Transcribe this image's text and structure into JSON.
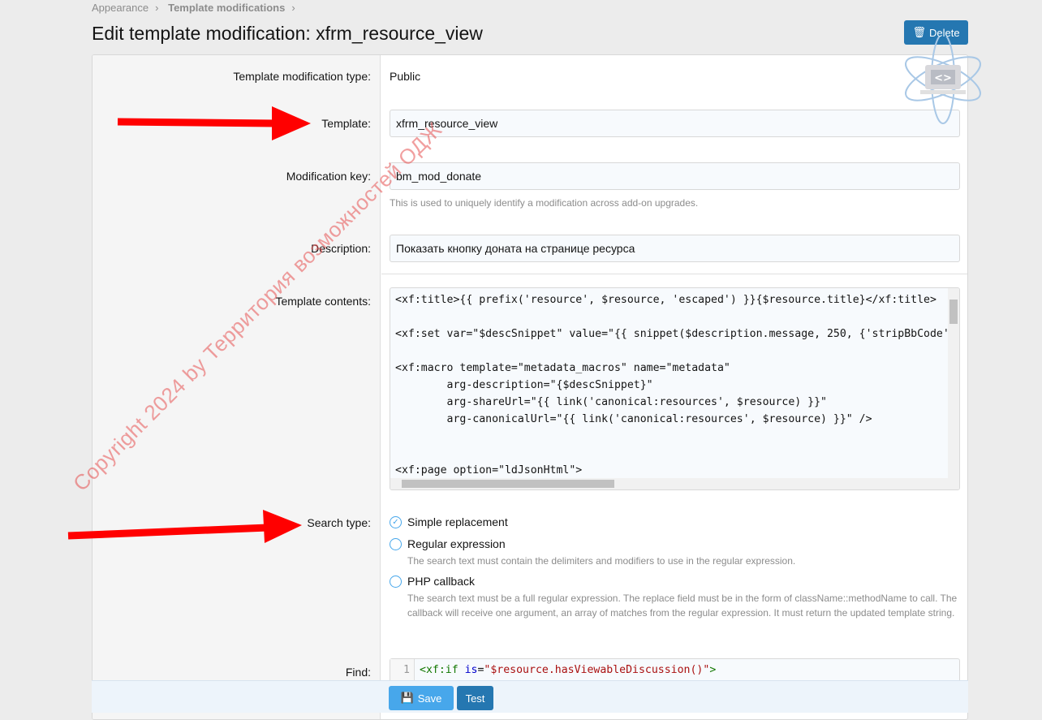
{
  "breadcrumb": [
    "Appearance",
    "Template modifications"
  ],
  "title": "Edit template modification: xfrm_resource_view",
  "delete_label": "Delete",
  "fields": {
    "type_label": "Template modification type:",
    "type_value": "Public",
    "template_label": "Template:",
    "template_value": "xfrm_resource_view",
    "key_label": "Modification key:",
    "key_value": "bm_mod_donate",
    "key_hint": "This is used to uniquely identify a modification across add-on upgrades.",
    "desc_label": "Description:",
    "desc_value": "Показать кнопку доната на странице ресурса",
    "contents_label": "Template contents:",
    "contents": "<xf:title>{{ prefix('resource', $resource, 'escaped') }}{$resource.title}</xf:title>\n\n<xf:set var=\"$descSnippet\" value=\"{{ snippet($description.message, 250, {'stripBbCode': true}) }}\" />\n\n<xf:macro template=\"metadata_macros\" name=\"metadata\"\n\targ-description=\"{$descSnippet}\"\n\targ-shareUrl=\"{{ link('canonical:resources', $resource) }}\"\n\targ-canonicalUrl=\"{{ link('canonical:resources', $resource) }}\" />\n\n\n<xf:page option=\"ldJsonHtml\">",
    "search_label": "Search type:",
    "search_options": [
      {
        "label": "Simple replacement",
        "checked": true,
        "hint": ""
      },
      {
        "label": "Regular expression",
        "checked": false,
        "hint": "The search text must contain the delimiters and modifiers to use in the regular expression."
      },
      {
        "label": "PHP callback",
        "checked": false,
        "hint": "The search text must be a full regular expression. The replace field must be in the form of className::methodName to call. The callback will receive one argument, an array of matches from the regular expression. It must return the updated template string."
      }
    ],
    "find_label": "Find:",
    "find_line_no": "1",
    "find_tag": "<xf:if ",
    "find_attr": "is",
    "find_eq": "=",
    "find_str": "\"$resource.hasViewableDiscussion()\"",
    "find_end": ">"
  },
  "save_label": "Save",
  "test_label": "Test",
  "watermark": "Copyright 2024 by Территория возможностей ОДЖ",
  "logo_text": "xf-forum.ru",
  "colors": {
    "primary": "#2577b1",
    "accent": "#47a7eb",
    "arrow": "#ff0000"
  }
}
